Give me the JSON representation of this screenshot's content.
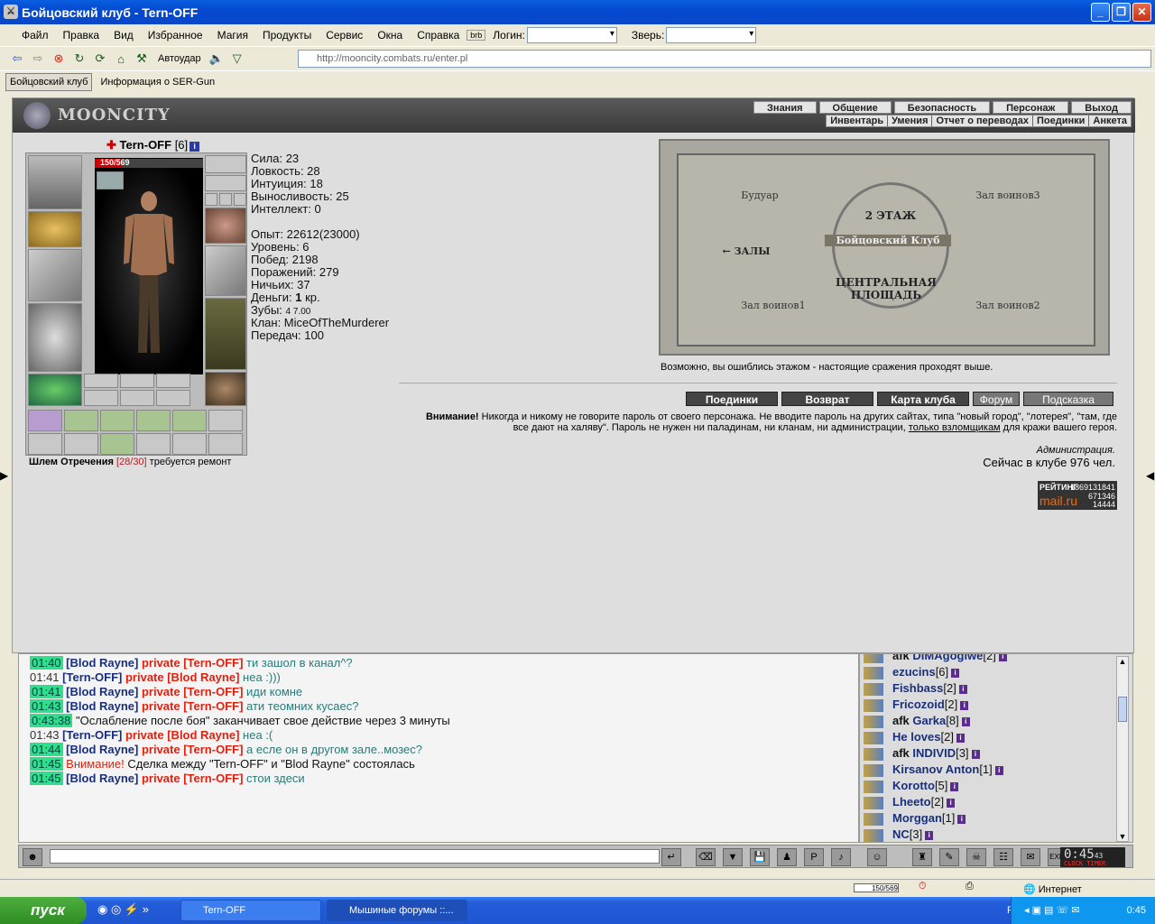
{
  "window": {
    "title": "Бойцовский клуб - Tern-OFF"
  },
  "menu": {
    "items": [
      "Файл",
      "Правка",
      "Вид",
      "Избранное",
      "Магия",
      "Продукты",
      "Сервис",
      "Окна",
      "Справка"
    ],
    "login_label": "Логин:",
    "beast_label": "Зверь:"
  },
  "toolbar": {
    "autohit_label": "Автоудар",
    "address": "http://mooncity.combats.ru/enter.pl"
  },
  "tabs": [
    "Бойцовский клуб",
    "Информация о SER-Gun"
  ],
  "header": {
    "logo": "MOONCITY",
    "nav": [
      "Знания",
      "Общение",
      "Безопасность",
      "Персонаж",
      "Выход"
    ],
    "subnav": [
      "Инвентарь",
      "Умения",
      "Отчет о переводах",
      "Поединки",
      "Анкета"
    ]
  },
  "character": {
    "name": "Tern-OFF",
    "level": "[6]",
    "hp": "150/569",
    "hp_fraction": 0.26,
    "stats": [
      "Сила: 23",
      "Ловкость: 28",
      "Интуиция: 18",
      "Выносливость: 25",
      "Интеллект: 0"
    ],
    "info": [
      "Опыт: 22612(23000)",
      "Уровень: 6",
      "Побед: 2198",
      "Поражений: 279",
      "Ничьих: 37"
    ],
    "money_label": "Деньги: ",
    "money_value": "1",
    "money_unit": " кр.",
    "teeth_label": "Зубы: ",
    "teeth_value": "4  7.00",
    "clan": "Клан: MiceOfTheMurderer",
    "transfers": "Передач: 100",
    "item_status_name": "Шлем Отречения",
    "item_status_dur": "[28/30]",
    "item_status_note": "требуется ремонт"
  },
  "map": {
    "rooms": [
      "Будуар",
      "Зал воинов3",
      "Зал воинов1",
      "Зал воинов2"
    ],
    "floor": "2 ЭТАЖ",
    "center": "Бойцовский Клуб",
    "halls": "← ЗАЛЫ",
    "square_line1": "ЦЕНТРАЛЬНАЯ",
    "square_line2": "ПЛОЩАДЬ",
    "hint": "Возможно, вы ошиблись этажом - настоящие сражения проходят выше."
  },
  "buttons": [
    "Поединки",
    "Возврат",
    "Карта клуба",
    "Форум",
    "Подсказка"
  ],
  "warning": {
    "bold": "Внимание!",
    "text1": " Никогда и никому не говорите пароль от своего персонажа. Не вводите пароль на других сайтах, типа \"новый город\", \"лотерея\", \"там, где все дают на халяву\". Пароль не нужен ни паладинам, ни кланам, ни администрации, ",
    "link": "только взломщикам",
    "text2": " для кражи вашего героя.",
    "admin": "Администрация.",
    "online": "Сейчас в клубе 976 чел."
  },
  "rating": {
    "line1": "РЕЙТИНГ",
    "line2": "mail.ru",
    "n1": "1869131841",
    "n2": "671346",
    "n3": "14444"
  },
  "chat": [
    {
      "time": "01:40",
      "hl": true,
      "from": "[Blod Rayne]",
      "priv": "private [Tern-OFF]",
      "msg": "ти зашол в канал^?"
    },
    {
      "time": "01:41",
      "hl": false,
      "from": "[Tern-OFF]",
      "priv": "private [Blod Rayne]",
      "msg": "неа :)))"
    },
    {
      "time": "01:41",
      "hl": true,
      "from": "[Blod Rayne]",
      "priv": "private [Tern-OFF]",
      "msg": "иди комне"
    },
    {
      "time": "01:43",
      "hl": true,
      "from": "[Blod Rayne]",
      "priv": "private [Tern-OFF]",
      "msg": "ати теомних кусаес?"
    },
    {
      "time": "0:43:38",
      "hl": true,
      "from": "",
      "priv": "",
      "msg": "\"Ослабление после боя\" заканчивает свое действие через 3 минуты",
      "sys": true
    },
    {
      "time": "01:43",
      "hl": false,
      "from": "[Tern-OFF]",
      "priv": "private [Blod Rayne]",
      "msg": "неа :("
    },
    {
      "time": "01:44",
      "hl": true,
      "from": "[Blod Rayne]",
      "priv": "private [Tern-OFF]",
      "msg": "а есле он в другом зале..мозес?"
    },
    {
      "time": "01:45",
      "hl": true,
      "from": "",
      "priv": "Внимание!",
      "msg": "Сделка между \"Tern-OFF\" и \"Blod Rayne\" состоялась",
      "sys": true
    },
    {
      "time": "01:45",
      "hl": true,
      "from": "[Blod Rayne]",
      "priv": "private [Tern-OFF]",
      "msg": "стои здеси"
    }
  ],
  "users": [
    {
      "afk": "afk ",
      "name": "DIMAgogiwe",
      "lvl": "[2]"
    },
    {
      "afk": "",
      "name": "ezucins",
      "lvl": "[6]"
    },
    {
      "afk": "",
      "name": "Fishbass",
      "lvl": "[2]"
    },
    {
      "afk": "",
      "name": "Fricozoid",
      "lvl": "[2]"
    },
    {
      "afk": "afk ",
      "name": "Garka",
      "lvl": "[8]"
    },
    {
      "afk": "",
      "name": "He loves",
      "lvl": "[2]"
    },
    {
      "afk": "afk ",
      "name": "INDIVID",
      "lvl": "[3]"
    },
    {
      "afk": "",
      "name": "Kirsanov Anton",
      "lvl": "[1]"
    },
    {
      "afk": "",
      "name": "Korotto",
      "lvl": "[5]"
    },
    {
      "afk": "",
      "name": "Lheeto",
      "lvl": "[2]"
    },
    {
      "afk": "",
      "name": "Morggan",
      "lvl": "[1]"
    },
    {
      "afk": "",
      "name": "NC",
      "lvl": "[3]"
    }
  ],
  "clock": {
    "time": "0:45",
    "sec": "43",
    "label": "CLOCK TIMER",
    "exit": "EXIT"
  },
  "status": {
    "hp": "150/569",
    "zone": "Интернет"
  },
  "taskbar": {
    "start": "пуск",
    "tasks": [
      "Tern-OFF",
      "Мышиные форумы ::..."
    ],
    "lang": "RU",
    "time": "0:45"
  }
}
